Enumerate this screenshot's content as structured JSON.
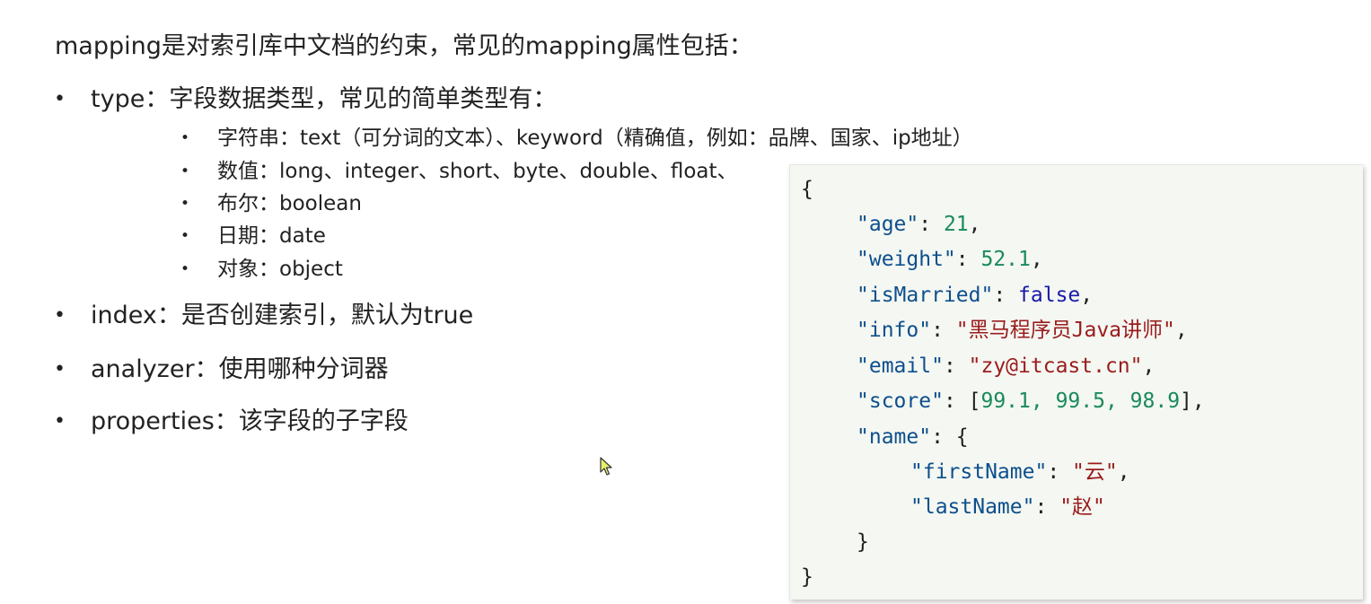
{
  "intro": "mapping是对索引库中文档的约束，常见的mapping属性包括：",
  "bullet_char": "•",
  "items": {
    "type": "type：字段数据类型，常见的简单类型有：",
    "sub": [
      "字符串：text（可分词的文本）、keyword（精确值，例如：品牌、国家、ip地址）",
      "数值：long、integer、short、byte、double、float、",
      "布尔：boolean",
      "日期：date",
      "对象：object"
    ],
    "index": "index：是否创建索引，默认为true",
    "analyzer": "analyzer：使用哪种分词器",
    "properties": "properties：该字段的子字段"
  },
  "code": {
    "open_brace": "{",
    "close_brace": "}",
    "name_close": "}",
    "age_key": "\"age\"",
    "age_val": "21",
    "weight_key": "\"weight\"",
    "weight_val": "52.1",
    "married_key": "\"isMarried\"",
    "married_val": "false",
    "info_key": "\"info\"",
    "info_val": "\"黑马程序员Java讲师\"",
    "email_key": "\"email\"",
    "email_val": "\"zy@itcast.cn\"",
    "score_key": "\"score\"",
    "score_val": "99.1, 99.5, 98.9",
    "name_key": "\"name\"",
    "first_key": "\"firstName\"",
    "first_val": "\"云\"",
    "last_key": "\"lastName\"",
    "last_val": "\"赵\""
  },
  "colors": {
    "key": "#0d4f8c",
    "number": "#1a8a5a",
    "string": "#9a1c1c",
    "keyword": "#1a1aa8",
    "code_bg": "#f4f7f2"
  },
  "icons": {
    "cursor": "mouse-pointer-icon"
  }
}
